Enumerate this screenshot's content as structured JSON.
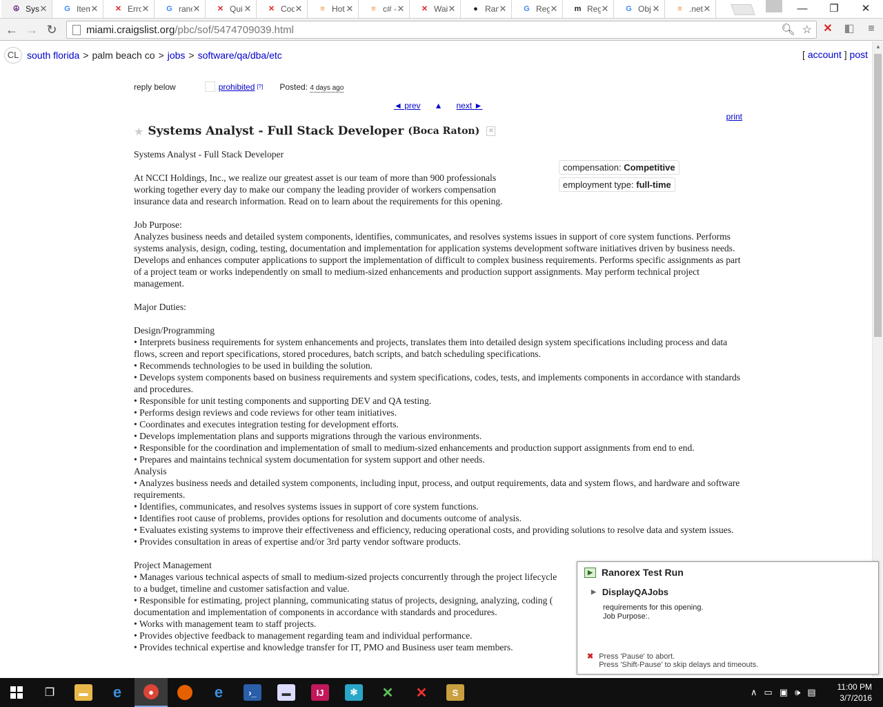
{
  "browser": {
    "tabs": [
      {
        "title": "Syst",
        "active": true,
        "icon": "craigslist-peace-icon",
        "glyph": "☮",
        "color": "#6b2e8a"
      },
      {
        "title": "Item",
        "active": false,
        "icon": "google-icon",
        "glyph": "G",
        "color": "#4285f4"
      },
      {
        "title": "Erro",
        "active": false,
        "icon": "ranorex-icon",
        "glyph": "✕",
        "color": "#d22"
      },
      {
        "title": "ranc",
        "active": false,
        "icon": "google-icon",
        "glyph": "G",
        "color": "#4285f4"
      },
      {
        "title": "Qui",
        "active": false,
        "icon": "ranorex-icon",
        "glyph": "✕",
        "color": "#d22"
      },
      {
        "title": "Cod",
        "active": false,
        "icon": "ranorex-icon",
        "glyph": "✕",
        "color": "#d22"
      },
      {
        "title": "Hot",
        "active": false,
        "icon": "stackoverflow-icon",
        "glyph": "≡",
        "color": "#f48024"
      },
      {
        "title": "c# -",
        "active": false,
        "icon": "stackoverflow-icon",
        "glyph": "≡",
        "color": "#f48024"
      },
      {
        "title": "Wai",
        "active": false,
        "icon": "ranorex-icon",
        "glyph": "✕",
        "color": "#d22"
      },
      {
        "title": "Ran",
        "active": false,
        "icon": "github-icon",
        "glyph": "●",
        "color": "#222"
      },
      {
        "title": "Reg",
        "active": false,
        "icon": "google-icon",
        "glyph": "G",
        "color": "#4285f4"
      },
      {
        "title": "Reg",
        "active": false,
        "icon": "medium-icon",
        "glyph": "m",
        "color": "#222"
      },
      {
        "title": "Obj",
        "active": false,
        "icon": "google-icon",
        "glyph": "G",
        "color": "#4285f4"
      },
      {
        "title": ".net",
        "active": false,
        "icon": "stackoverflow-icon",
        "glyph": "≡",
        "color": "#f48024"
      }
    ],
    "url_host": "miami.craigslist.org",
    "url_path": "/pbc/sof/5474709039.html"
  },
  "craigslist": {
    "logo": "CL",
    "breadcrumbs": {
      "area": "south florida",
      "subarea": "palm beach co",
      "category": "jobs",
      "subcategory": "software/qa/dba/etc"
    },
    "account": "account",
    "post": "post",
    "reply": "reply below",
    "prohibited": "prohibited",
    "help": "[?]",
    "posted_label": "Posted:",
    "posted_date": "4 days ago",
    "prev": "◄ prev",
    "up": "▲",
    "next": "next ►",
    "print": "print",
    "title": "Systems Analyst - Full Stack Developer",
    "location": "(Boca Raton)",
    "attrs": {
      "compensation_label": "compensation:",
      "compensation": "Competitive",
      "employment_label": "employment type:",
      "employment": "full-time"
    },
    "body": {
      "heading": "Systems Analyst - Full Stack Developer",
      "intro": "At NCCI Holdings, Inc., we realize our greatest asset is our team of more than 900 professionals working together every day to make our company the leading provider of workers compensation insurance data and research information. Read on to learn about the requirements for this opening.",
      "purpose_heading": "Job Purpose:",
      "purpose": "Analyzes business needs and detailed system components, identifies, communicates, and resolves systems issues in support of core system functions. Performs systems analysis, design, coding, testing, documentation and implementation for application systems development software initiatives driven by business needs. Develops and enhances computer applications to support the implementation of difficult to complex business requirements. Performs specific assignments as part of a project team or works independently on small to medium-sized enhancements and production support assignments. May perform technical project management.",
      "duties_heading": "Major Duties:",
      "design_heading": "Design/Programming",
      "design": [
        "• Interprets business requirements for system enhancements and projects, translates them into detailed design system specifications including process and data flows, screen and report specifications, stored procedures, batch scripts, and batch scheduling specifications.",
        "• Recommends technologies to be used in building the solution.",
        "• Develops system components based on business requirements and system specifications, codes, tests, and implements components in accordance with standards and procedures.",
        "• Responsible for unit testing components and supporting DEV and QA testing.",
        "• Performs design reviews and code reviews for other team initiatives.",
        "• Coordinates and executes integration testing for development efforts.",
        "• Develops implementation plans and supports migrations through the various environments.",
        "• Responsible for the coordination and implementation of small to medium-sized enhancements and production support assignments from end to end.",
        "• Prepares and maintains technical system documentation for system support and other needs."
      ],
      "analysis_heading": "Analysis",
      "analysis": [
        "• Analyzes business needs and detailed system components, including input, process, and output requirements, data and system flows, and hardware and software requirements.",
        "• Identifies, communicates, and resolves systems issues in support of core system functions.",
        "• Identifies root cause of problems, provides options for resolution and documents outcome of analysis.",
        "• Evaluates existing systems to improve their effectiveness and efficiency, reducing operational costs, and providing solutions to resolve data and system issues.",
        "• Provides consultation in areas of expertise and/or 3rd party vendor software products."
      ],
      "pm_heading": "Project Management",
      "pm": [
        "• Manages various technical aspects of small to medium-sized projects concurrently through the project lifecycle",
        "to a budget, timeline and customer satisfaction and value.",
        "• Responsible for estimating, project planning, communicating status of projects, designing, analyzing, coding (",
        "documentation and implementation of components in accordance with standards and procedures.",
        "• Works with management team to staff projects.",
        "• Provides objective feedback to management regarding team and individual performance.",
        "• Provides technical expertise and knowledge transfer for IT, PMO and Business user team members."
      ]
    }
  },
  "ranorex": {
    "title": "Ranorex Test Run",
    "test": "DisplayQAJobs",
    "message_line1": "requirements for this opening.",
    "message_line2": "Job Purpose:.",
    "hint1": "Press 'Pause' to abort.",
    "hint2": "Press 'Shift-Pause' to skip delays and timeouts."
  },
  "taskbar": {
    "time": "11:00 PM",
    "date": "3/7/2016"
  }
}
